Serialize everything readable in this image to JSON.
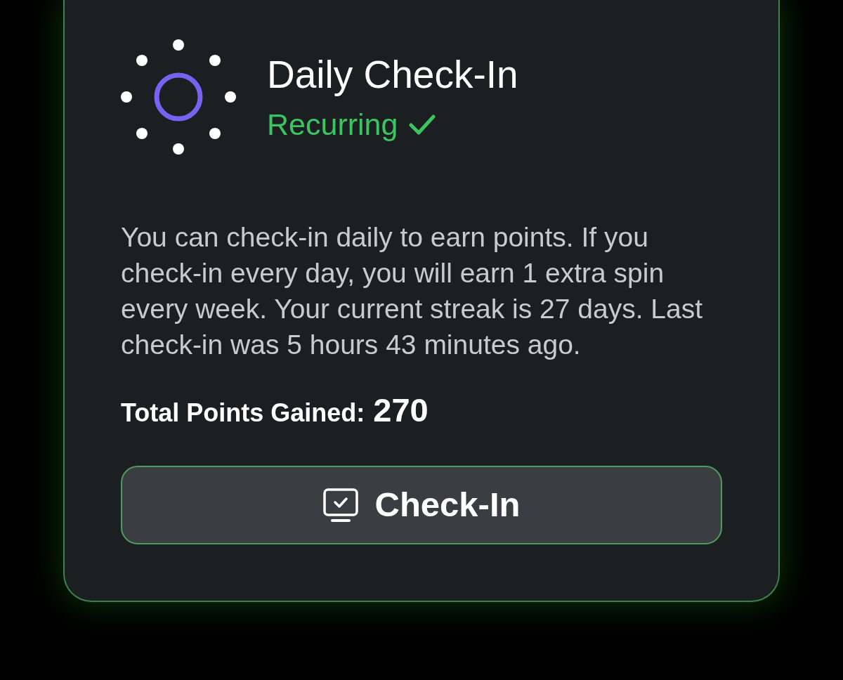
{
  "card": {
    "title": "Daily Check-In",
    "status": {
      "label": "Recurring"
    },
    "description": "You can check-in daily to earn points. If you check-in every day, you will earn 1 extra spin every week. Your current streak is 27 days. Last check-in was 5 hours 43 minutes ago.",
    "total": {
      "label": "Total Points Gained:",
      "value": "270"
    },
    "button": {
      "label": "Check-In"
    }
  }
}
